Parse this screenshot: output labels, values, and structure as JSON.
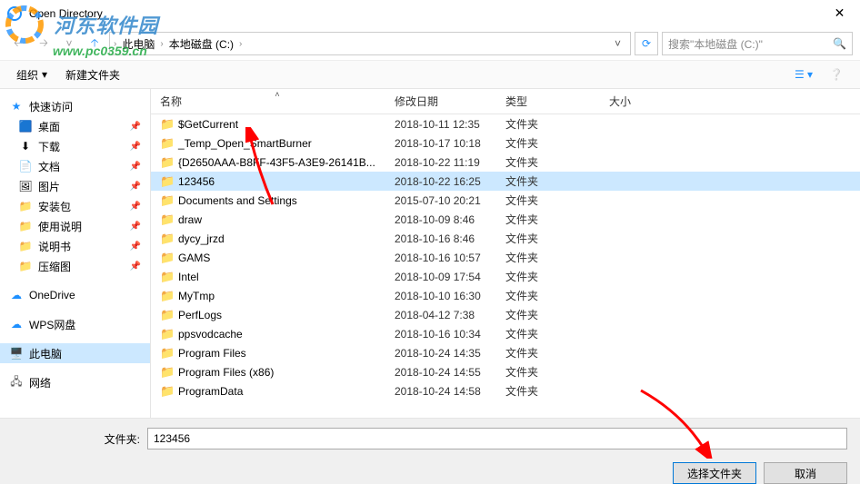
{
  "window": {
    "title": "Open Directory"
  },
  "breadcrumb": {
    "pc": "此电脑",
    "drive": "本地磁盘 (C:)"
  },
  "search": {
    "placeholder": "搜索\"本地磁盘 (C:)\""
  },
  "toolbar": {
    "organize": "组织",
    "newfolder": "新建文件夹"
  },
  "sidebar": {
    "quick": "快速访问",
    "items": [
      {
        "label": "桌面"
      },
      {
        "label": "下载"
      },
      {
        "label": "文档"
      },
      {
        "label": "图片"
      },
      {
        "label": "安装包"
      },
      {
        "label": "使用说明"
      },
      {
        "label": "说明书"
      },
      {
        "label": "压缩图"
      }
    ],
    "onedrive": "OneDrive",
    "wps": "WPS网盘",
    "thispc": "此电脑",
    "network": "网络"
  },
  "columns": {
    "name": "名称",
    "date": "修改日期",
    "type": "类型",
    "size": "大小"
  },
  "files": [
    {
      "name": "$GetCurrent",
      "date": "2018-10-11 12:35",
      "type": "文件夹",
      "selected": false
    },
    {
      "name": "_Temp_Open_SmartBurner",
      "date": "2018-10-17 10:18",
      "type": "文件夹",
      "selected": false
    },
    {
      "name": "{D2650AAA-B8FF-43F5-A3E9-26141B...",
      "date": "2018-10-22 11:19",
      "type": "文件夹",
      "selected": false
    },
    {
      "name": "123456",
      "date": "2018-10-22 16:25",
      "type": "文件夹",
      "selected": true
    },
    {
      "name": "Documents and Settings",
      "date": "2015-07-10 20:21",
      "type": "文件夹",
      "selected": false
    },
    {
      "name": "draw",
      "date": "2018-10-09 8:46",
      "type": "文件夹",
      "selected": false
    },
    {
      "name": "dycy_jrzd",
      "date": "2018-10-16 8:46",
      "type": "文件夹",
      "selected": false
    },
    {
      "name": "GAMS",
      "date": "2018-10-16 10:57",
      "type": "文件夹",
      "selected": false
    },
    {
      "name": "Intel",
      "date": "2018-10-09 17:54",
      "type": "文件夹",
      "selected": false
    },
    {
      "name": "MyTmp",
      "date": "2018-10-10 16:30",
      "type": "文件夹",
      "selected": false
    },
    {
      "name": "PerfLogs",
      "date": "2018-04-12 7:38",
      "type": "文件夹",
      "selected": false
    },
    {
      "name": "ppsvodcache",
      "date": "2018-10-16 10:34",
      "type": "文件夹",
      "selected": false
    },
    {
      "name": "Program Files",
      "date": "2018-10-24 14:35",
      "type": "文件夹",
      "selected": false
    },
    {
      "name": "Program Files (x86)",
      "date": "2018-10-24 14:55",
      "type": "文件夹",
      "selected": false
    },
    {
      "name": "ProgramData",
      "date": "2018-10-24 14:58",
      "type": "文件夹",
      "selected": false
    }
  ],
  "bottom": {
    "label": "文件夹:",
    "value": "123456",
    "select": "选择文件夹",
    "cancel": "取消"
  },
  "watermark": {
    "text": "河东软件园",
    "url": "www.pc0359.cn"
  }
}
